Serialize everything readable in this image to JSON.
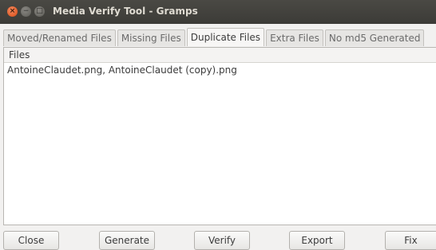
{
  "window": {
    "title": "Media Verify Tool - Gramps"
  },
  "window_controls": {
    "close_glyph": "×",
    "minimize_glyph": "−",
    "maximize_glyph": "□"
  },
  "tabs": [
    {
      "label": "Moved/Renamed Files"
    },
    {
      "label": "Missing Files"
    },
    {
      "label": "Duplicate Files"
    },
    {
      "label": "Extra Files"
    },
    {
      "label": "No md5 Generated"
    }
  ],
  "active_tab_index": 2,
  "table": {
    "column_header": "Files",
    "rows": [
      "AntoineClaudet.png, AntoineClaudet (copy).png"
    ]
  },
  "buttons": {
    "close": "Close",
    "generate": "Generate",
    "verify": "Verify",
    "export": "Export",
    "fix": "Fix"
  }
}
